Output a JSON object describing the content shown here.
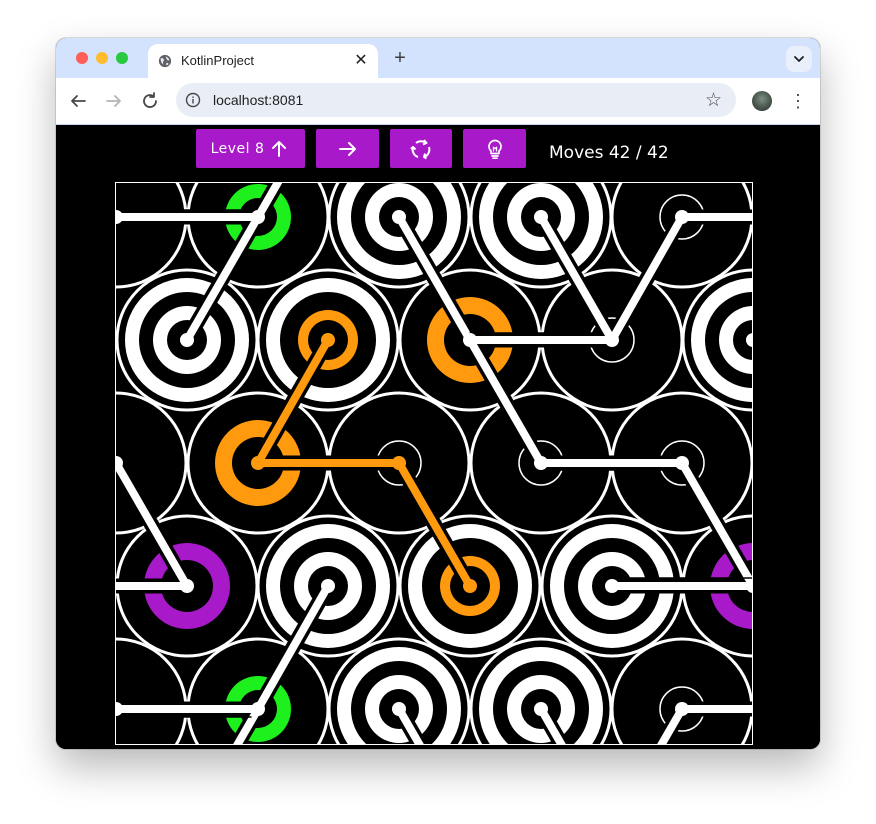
{
  "browser": {
    "tab_title": "KotlinProject",
    "tab_close_glyph": "✕",
    "new_tab_glyph": "+",
    "url": "localhost:8081",
    "back_glyph": "←",
    "forward_glyph": "→",
    "reload_glyph": "↻",
    "bookmark_glyph": "☆",
    "menu_glyph": "⋮",
    "tab_menu_glyph": "⌄",
    "icons": [
      "globe-icon",
      "info-icon",
      "star-icon",
      "avatar",
      "kebab-menu-icon"
    ]
  },
  "game": {
    "level_label": "Level 8",
    "level_icon": "arrow-up-icon",
    "next_icon": "arrow-right-icon",
    "restart_icon": "recycle-icon",
    "hint_icon": "lightbulb-icon",
    "moves_label": "Moves 42 / 42",
    "colors": {
      "button": "#a719c9",
      "green": "#1ef01e",
      "orange": "#ff9a0f",
      "purple": "#a719c9",
      "tile": "#000000",
      "line": "#ffffff"
    }
  }
}
